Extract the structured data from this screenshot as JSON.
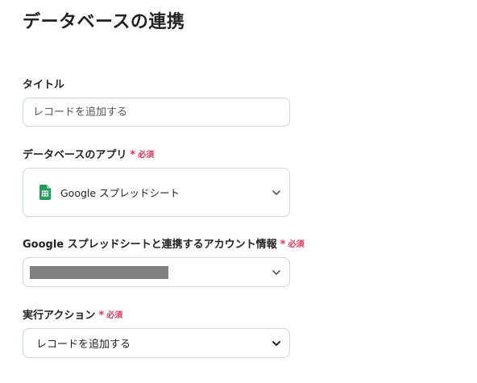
{
  "page": {
    "title": "データベースの連携"
  },
  "fields": {
    "title": {
      "label": "タイトル",
      "placeholder": "レコードを追加する"
    },
    "database_app": {
      "label": "データベースのアプリ",
      "required_text": "必須",
      "value": "Google スプレッドシート",
      "icon": "google-sheets-icon"
    },
    "account": {
      "label": "Google スプレッドシートと連携するアカウント情報",
      "required_text": "必須",
      "value_masked": true
    },
    "action": {
      "label": "実行アクション",
      "required_text": "必須",
      "value": "レコードを追加する"
    }
  },
  "colors": {
    "required": "#e0385a",
    "sheets_green": "#1e9e57",
    "border": "#cfd3da",
    "mask": "#808080"
  },
  "icons": {
    "dropdown": "chevron-down-icon"
  }
}
